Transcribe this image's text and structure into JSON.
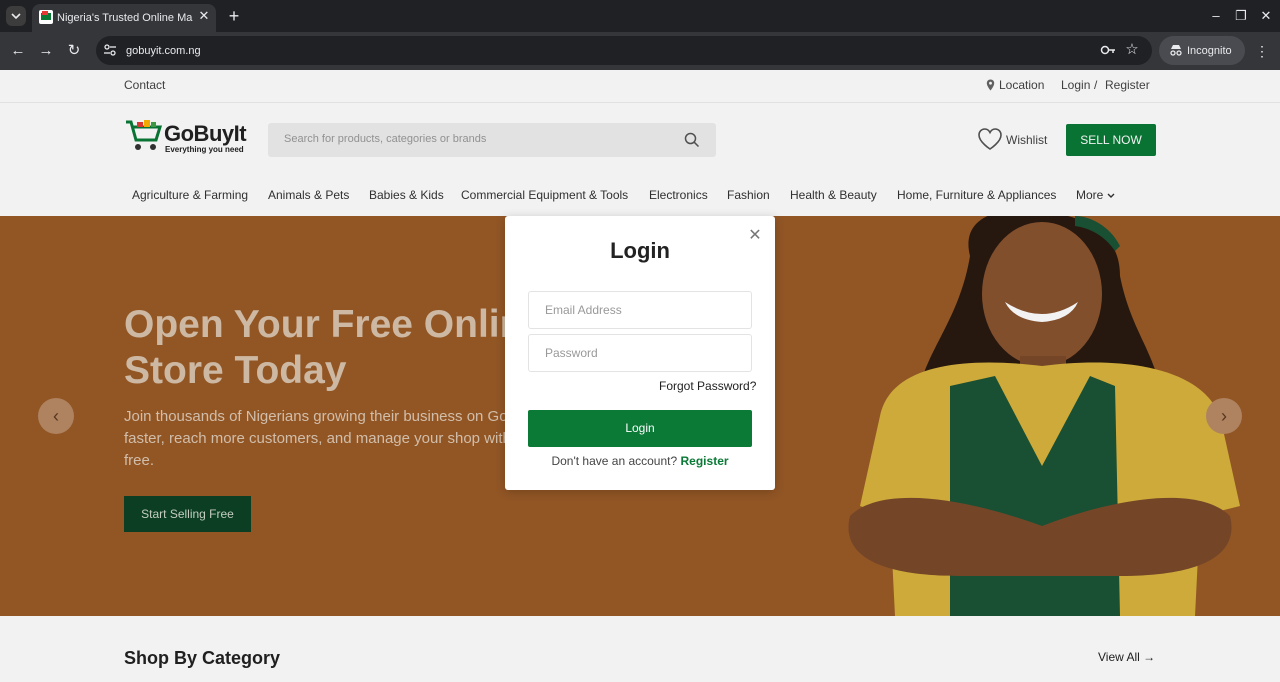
{
  "browser": {
    "tab_title": "Nigeria's Trusted Online Marketplace",
    "url": "gobuyit.com.ng",
    "incognito_label": "Incognito"
  },
  "topbar": {
    "contact": "Contact",
    "location": "Location",
    "login": "Login",
    "separator": "/",
    "register": "Register"
  },
  "header": {
    "brand": "GoBuyIt",
    "tagline": "Everything you need",
    "search_placeholder": "Search for products, categories or brands",
    "wishlist": "Wishlist",
    "sell_now": "SELL NOW"
  },
  "categories": [
    "Agriculture & Farming",
    "Animals & Pets",
    "Babies & Kids",
    "Commercial Equipment & Tools",
    "Electronics",
    "Fashion",
    "Health & Beauty",
    "Home, Furniture & Appliances",
    "More"
  ],
  "hero": {
    "headline_line1": "Open Your Free Online",
    "headline_line2": "Store Today",
    "sub_line1": "Join thousands of Nigerians growing their business on GoBuyIt. Sell",
    "sub_line2": "faster, reach more customers, and manage your shop with ease — all for",
    "sub_line3": "free.",
    "cta": "Start Selling Free"
  },
  "modal": {
    "title": "Login",
    "email_placeholder": "Email Address",
    "password_placeholder": "Password",
    "forgot": "Forgot Password?",
    "login_button": "Login",
    "no_account": "Don't have an account?",
    "register_link": "Register"
  },
  "section": {
    "title": "Shop By Category",
    "view_all": "View All →"
  },
  "colors": {
    "brand_green": "#0a7a36",
    "hero_bg": "#9a5b27",
    "cta_dark_green": "#0d4226"
  },
  "icons": [
    "search-icon",
    "heart-icon",
    "location-pin-icon",
    "close-icon",
    "chevron-left-icon",
    "chevron-right-icon",
    "chevron-down-icon",
    "key-icon",
    "star-icon",
    "incognito-icon"
  ]
}
